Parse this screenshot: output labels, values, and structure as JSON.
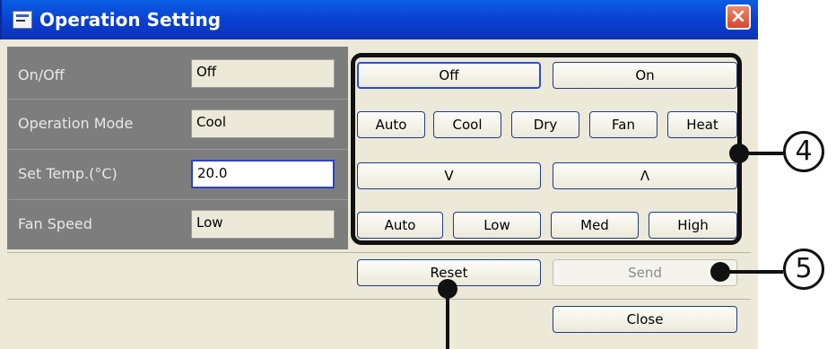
{
  "window": {
    "title": "Operation Setting",
    "close_glyph": "×"
  },
  "rows": [
    {
      "label": "On/Off",
      "value": "Off"
    },
    {
      "label": "Operation Mode",
      "value": "Cool"
    },
    {
      "label": "Set Temp.(°C)",
      "value": "20.0"
    },
    {
      "label": "Fan Speed",
      "value": "Low"
    }
  ],
  "onoff_buttons": {
    "off": "Off",
    "on": "On"
  },
  "mode_buttons": {
    "auto": "Auto",
    "cool": "Cool",
    "dry": "Dry",
    "fan": "Fan",
    "heat": "Heat"
  },
  "temp_buttons": {
    "down": "V",
    "up": "Λ"
  },
  "fan_buttons": {
    "auto": "Auto",
    "low": "Low",
    "med": "Med",
    "high": "High"
  },
  "footer": {
    "reset": "Reset",
    "send": "Send",
    "close": "Close"
  },
  "callouts": {
    "four": "4",
    "five": "5"
  },
  "icons": {
    "app": "window-app-icon",
    "close": "close-icon"
  }
}
